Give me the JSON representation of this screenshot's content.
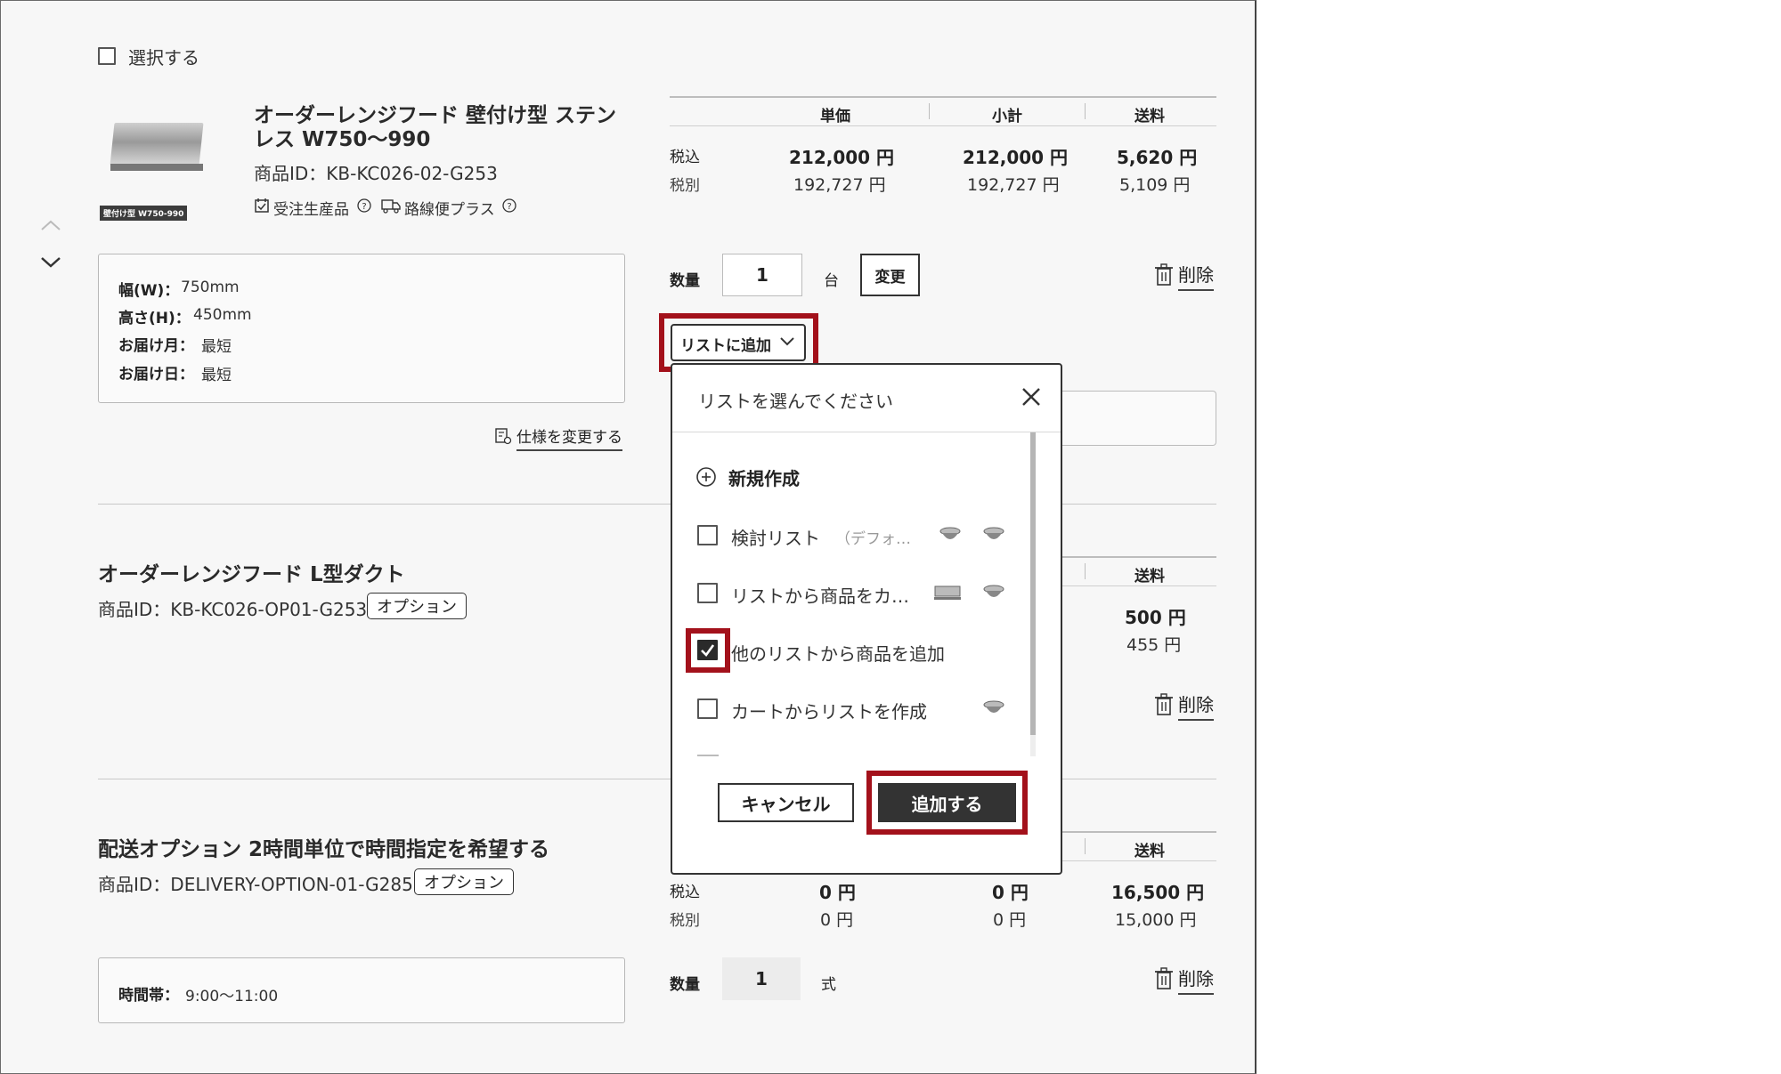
{
  "select_all": {
    "label": "選択する"
  },
  "items": [
    {
      "title_line1": "オーダーレンジフード 壁付け型 ステン",
      "title_line2": "レス W750〜990",
      "product_id": "商品ID：KB-KC026-02-G253",
      "thumb_caption": "壁付け型 W750-990",
      "tag_made_to_order": "受注生産品",
      "tag_delivery": "路線便プラス",
      "price_headers": {
        "unit": "単価",
        "subtotal": "小計",
        "shipping": "送料"
      },
      "tax_in_label": "税込",
      "tax_ex_label": "税別",
      "unit_price_in": "212,000 円",
      "unit_price_ex": "192,727 円",
      "subtotal_in": "212,000 円",
      "subtotal_ex": "192,727 円",
      "shipping_in": "5,620 円",
      "shipping_ex": "5,109 円",
      "specs": [
        {
          "label": "幅(W)：",
          "value": "750mm"
        },
        {
          "label": "高さ(H)：",
          "value": "450mm"
        },
        {
          "label": "お届け月：",
          "value": "最短"
        },
        {
          "label": "お届け日：",
          "value": "最短"
        }
      ],
      "change_spec_link": "仕様を変更する",
      "quantity_label": "数量",
      "quantity": "1",
      "quantity_unit": "台",
      "change_button": "変更",
      "delete_label": "削除",
      "add_to_list_button": "リストに追加"
    },
    {
      "title": "オーダーレンジフード L型ダクト",
      "product_id": "商品ID：KB-KC026-OP01-G253",
      "badge": "オプション",
      "shipping_header": "送料",
      "shipping_in": "500 円",
      "shipping_ex": "455 円",
      "delete_label": "削除"
    },
    {
      "title": "配送オプション 2時間単位で時間指定を希望する",
      "product_id": "商品ID：DELIVERY-OPTION-01-G285",
      "badge": "オプション",
      "shipping_header": "送料",
      "tax_in_label": "税込",
      "tax_ex_label": "税別",
      "unit_price_in": "0 円",
      "unit_price_ex": "0 円",
      "subtotal_in": "0 円",
      "subtotal_ex": "0 円",
      "shipping_in": "16,500 円",
      "shipping_ex": "15,000 円",
      "spec_label": "時間帯：",
      "spec_value": "9:00〜11:00",
      "quantity_label": "数量",
      "quantity": "1",
      "quantity_unit": "式",
      "delete_label": "削除"
    }
  ],
  "list_popup": {
    "title": "リストを選んでください",
    "new_list": "新規作成",
    "lists": [
      {
        "name": "検討リスト",
        "note": "（デフォ…",
        "checked": false
      },
      {
        "name": "リストから商品をカ…",
        "note": "",
        "checked": false
      },
      {
        "name": "他のリストから商品を追加",
        "note": "",
        "checked": true
      },
      {
        "name": "カートからリストを作成",
        "note": "",
        "checked": false
      }
    ],
    "cancel_button": "キャンセル",
    "add_button": "追加する"
  },
  "colors": {
    "highlight": "#a3111b",
    "dark_button": "#333333",
    "panel_bg": "#f7f7f7"
  }
}
